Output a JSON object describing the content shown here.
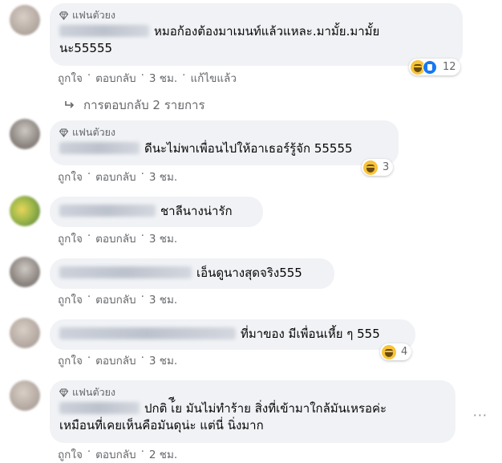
{
  "badge_label": "แฟนตัวยง",
  "comments": [
    {
      "lines": [
        "หมอก้องต้องมาเมนท์แล้วแหละ.มามั้ย.มามั้ย",
        "นะ55555"
      ],
      "react_count": "12",
      "like": "ถูกใจ",
      "reply": "ตอบกลับ",
      "time": "3 ชม.",
      "edited": "แก้ไขแล้ว",
      "replies": "การตอบกลับ 2 รายการ"
    },
    {
      "lines": [
        "ดีนะไม่พาเพื่อนไปให้อาเธอร์รู้จัก 55555"
      ],
      "react_count": "3",
      "like": "ถูกใจ",
      "reply": "ตอบกลับ",
      "time": "3 ชม."
    },
    {
      "lines": [
        "ชาลีนางน่ารัก"
      ],
      "like": "ถูกใจ",
      "reply": "ตอบกลับ",
      "time": "3 ชม."
    },
    {
      "lines": [
        "เอ็นดูนางสุดจริง555"
      ],
      "like": "ถูกใจ",
      "reply": "ตอบกลับ",
      "time": "3 ชม."
    },
    {
      "lines": [
        "ที่มาของ มีเพื่อนเหี้ย ๆ 555"
      ],
      "react_count": "4",
      "like": "ถูกใจ",
      "reply": "ตอบกลับ",
      "time": "3 ชม."
    },
    {
      "lines": [
        "ปกติ เ้ีย มันไม่ทำร้าย สิ่งที่เข้ามาใกล้มันเหรอค่ะ",
        "เหมือนที่เคยเห็นคือมันดุน่ะ แต่นี่ นิ่งมาก"
      ],
      "like": "ถูกใจ",
      "reply": "ตอบกลับ",
      "time": "2 ชม."
    }
  ],
  "more_dots": "···",
  "icons": {
    "badge": "diamond-icon",
    "replies": "reply-arrow-icon",
    "reactions": [
      "haha-icon",
      "like-icon"
    ]
  },
  "colors": {
    "bubble": "#f0f2f5",
    "meta": "#65676b",
    "text": "#050505"
  }
}
